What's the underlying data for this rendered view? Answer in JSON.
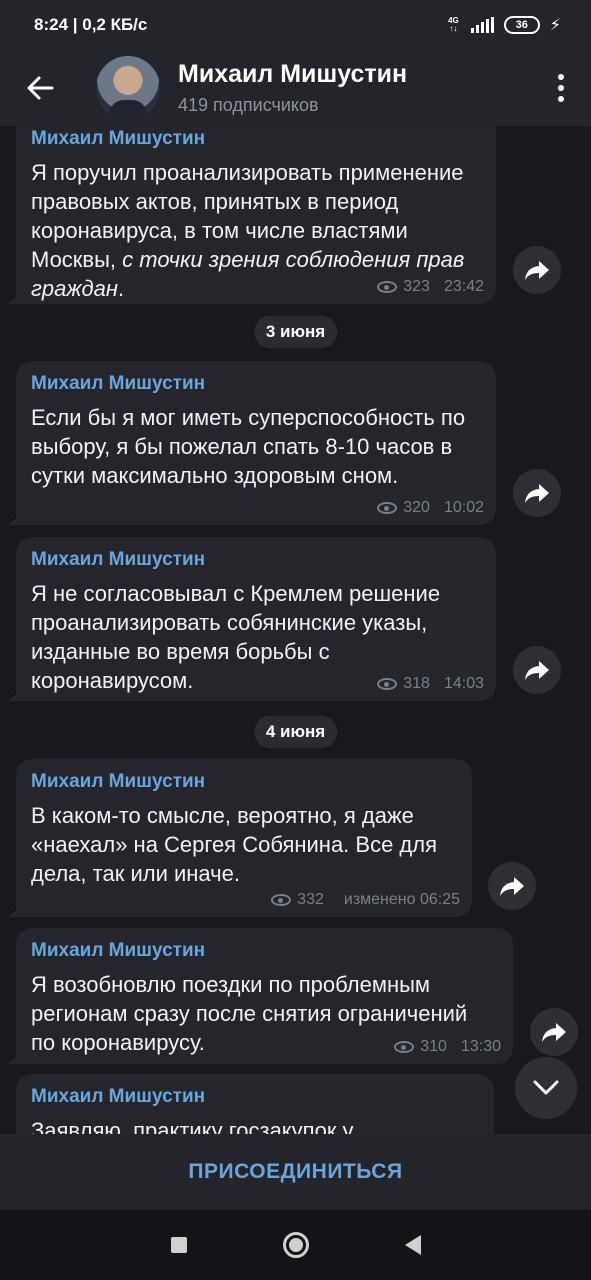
{
  "status": {
    "time": "8:24",
    "speed": "0,2 КБ/с",
    "network": "4G",
    "battery": "36"
  },
  "header": {
    "title": "Михаил Мишустин",
    "subtitle": "419 подписчиков"
  },
  "dates": [
    "3 июня",
    "4 июня"
  ],
  "messages": [
    {
      "author": "Михаил Мишустин",
      "text": "Я поручил проанализировать применение правовых актов, принятых в период коронавируса, в том числе властями Москвы,",
      "italic": "с точки зрения соблюдения прав граждан",
      "tail": ".",
      "views": "323",
      "time": "23:42"
    },
    {
      "author": "Михаил Мишустин",
      "text": "Если бы я мог иметь суперспособность по выбору, я бы пожелал спать 8-10 часов в сутки максимально здоровым сном.",
      "views": "320",
      "time": "10:02"
    },
    {
      "author": "Михаил Мишустин",
      "text": "Я не согласовывал с Кремлем решение проанализировать собянинские указы, изданные во время борьбы с коронавирусом.",
      "views": "318",
      "time": "14:03"
    },
    {
      "author": "Михаил Мишустин",
      "text": "В каком-то смысле, вероятно, я даже «наехал» на Сергея Собянина. Все для дела, так или иначе.",
      "views": "332",
      "time": "изменено 06:25"
    },
    {
      "author": "Михаил Мишустин",
      "text": "Я возобновлю поездки по проблемным регионам сразу после снятия ограничений по коронавирусу.",
      "views": "310",
      "time": "13:30"
    },
    {
      "author": "Михаил Мишустин",
      "text": "Заявляю, практику госзакупок у"
    }
  ],
  "join_label": "ПРИСОЕДИНИТЬСЯ"
}
